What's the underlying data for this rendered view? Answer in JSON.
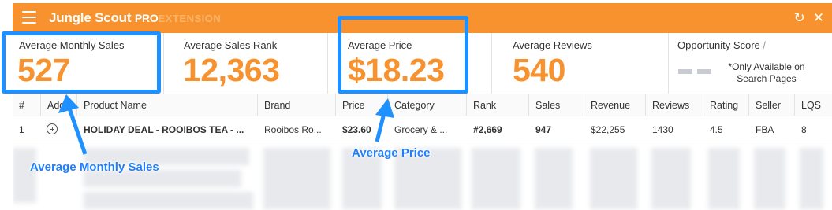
{
  "header": {
    "brand_name": "Jungle Scout",
    "brand_pro": "PRO",
    "brand_extension": "EXTENSION",
    "icons": [
      "menu-icon",
      "refresh-icon",
      "close-icon"
    ],
    "accent_color": "#f7922e"
  },
  "metrics": [
    {
      "label": "Average Monthly Sales",
      "value": "527"
    },
    {
      "label": "Average Sales Rank",
      "value": "12,363"
    },
    {
      "label": "Average Price",
      "value": "$18.23"
    },
    {
      "label": "Average Reviews",
      "value": "540"
    }
  ],
  "opportunity": {
    "label": "Opportunity Score",
    "suffix": "/",
    "note_line1": "*Only Available on",
    "note_line2": "Search Pages"
  },
  "table": {
    "columns": [
      "#",
      "Add",
      "Product Name",
      "Brand",
      "Price",
      "Category",
      "Rank",
      "Sales",
      "Revenue",
      "Reviews",
      "Rating",
      "Seller",
      "LQS"
    ],
    "rows": [
      {
        "num": "1",
        "product": "HOLIDAY DEAL - ROOIBOS TEA - ...",
        "brand": "Rooibos Ro...",
        "price": "$23.60",
        "category": "Grocery & ...",
        "rank": "#2,669",
        "sales": "947",
        "revenue": "$22,255",
        "reviews": "1430",
        "rating": "4.5",
        "seller": "FBA",
        "lqs": "8"
      }
    ]
  },
  "annotations": {
    "monthly_sales_callout": "Average Monthly Sales",
    "price_callout": "Average Price",
    "highlight_color": "#1e90ff"
  }
}
